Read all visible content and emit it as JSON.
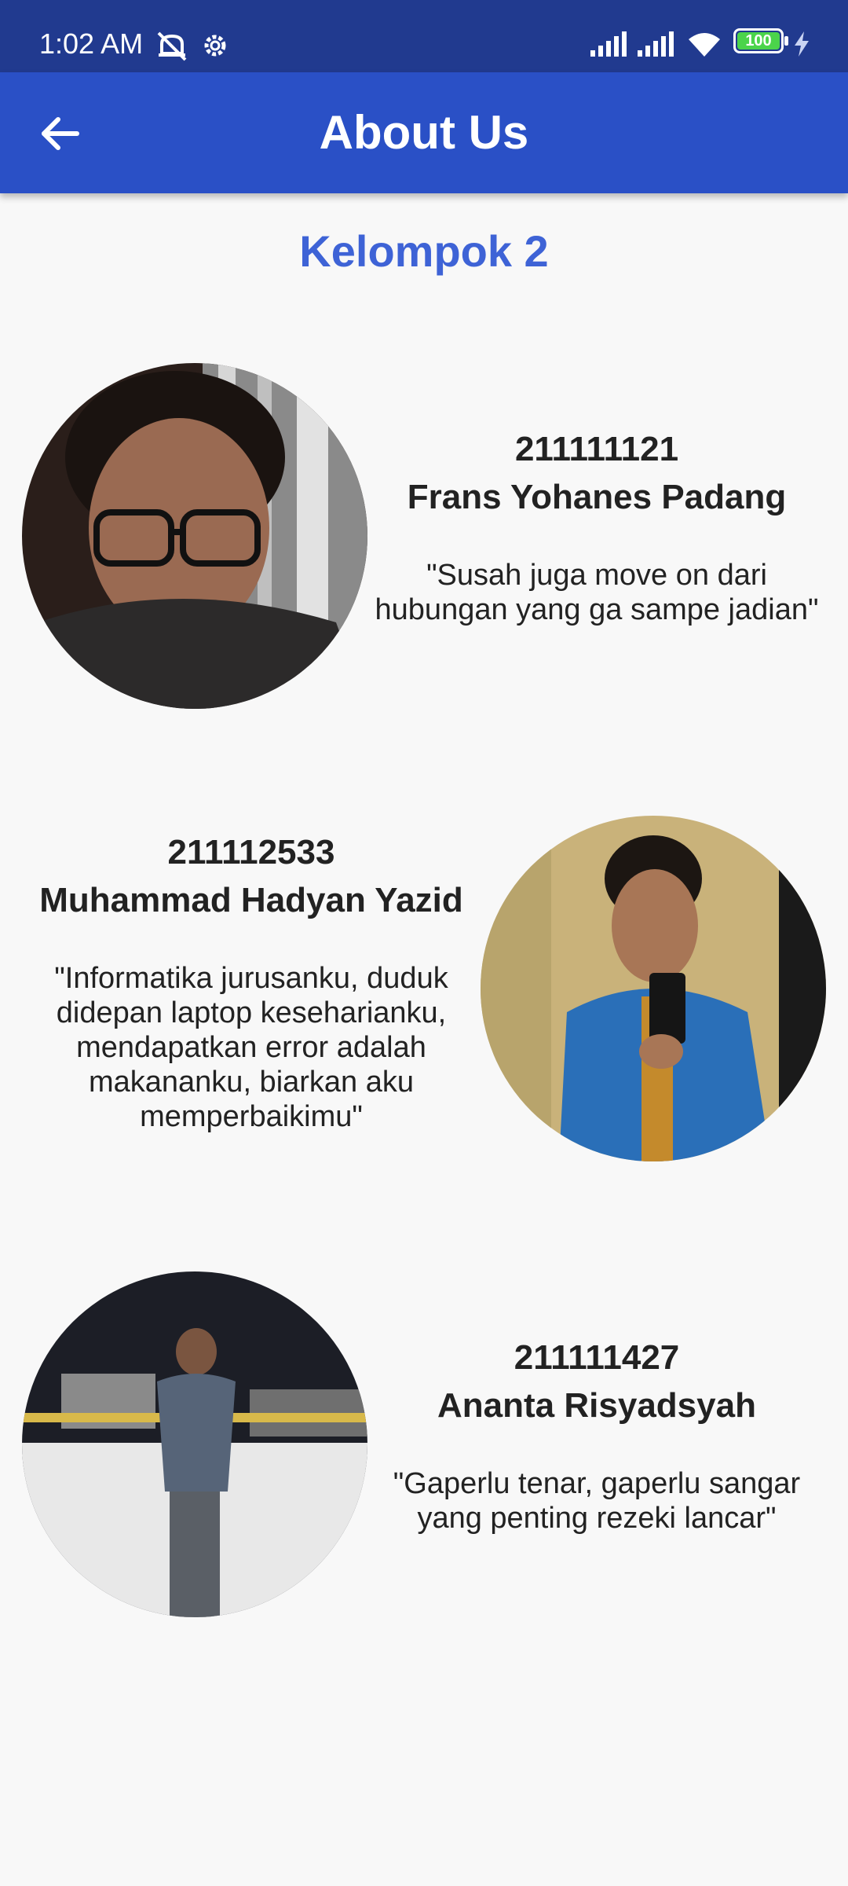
{
  "status_bar": {
    "time": "1:02 AM",
    "battery": "100",
    "icons": [
      "alarm-off-icon",
      "settings-gear-icon",
      "signal-icon",
      "signal-icon",
      "wifi-icon",
      "battery-icon",
      "charging-bolt-icon"
    ]
  },
  "app_bar": {
    "back_icon": "arrow-left-icon",
    "title": "About Us"
  },
  "group_title": "Kelompok 2",
  "members": [
    {
      "nim": "211111121",
      "name": "Frans Yohanes Padang",
      "quote": "\"Susah juga move on dari hubungan yang ga sampe jadian\""
    },
    {
      "nim": "211112533",
      "name": "Muhammad Hadyan Yazid",
      "quote": "\"Informatika jurusanku, duduk didepan laptop keseharianku, mendapatkan error adalah makananku, biarkan aku memperbaikimu\""
    },
    {
      "nim": "211111427",
      "name": "Ananta Risyadsyah",
      "quote": "\"Gaperlu tenar, gaperlu sangar yang penting rezeki lancar\""
    }
  ],
  "colors": {
    "status_bar": "#213a8f",
    "app_bar": "#2a50c6",
    "accent": "#3e63d6",
    "background": "#f8f8f8"
  }
}
